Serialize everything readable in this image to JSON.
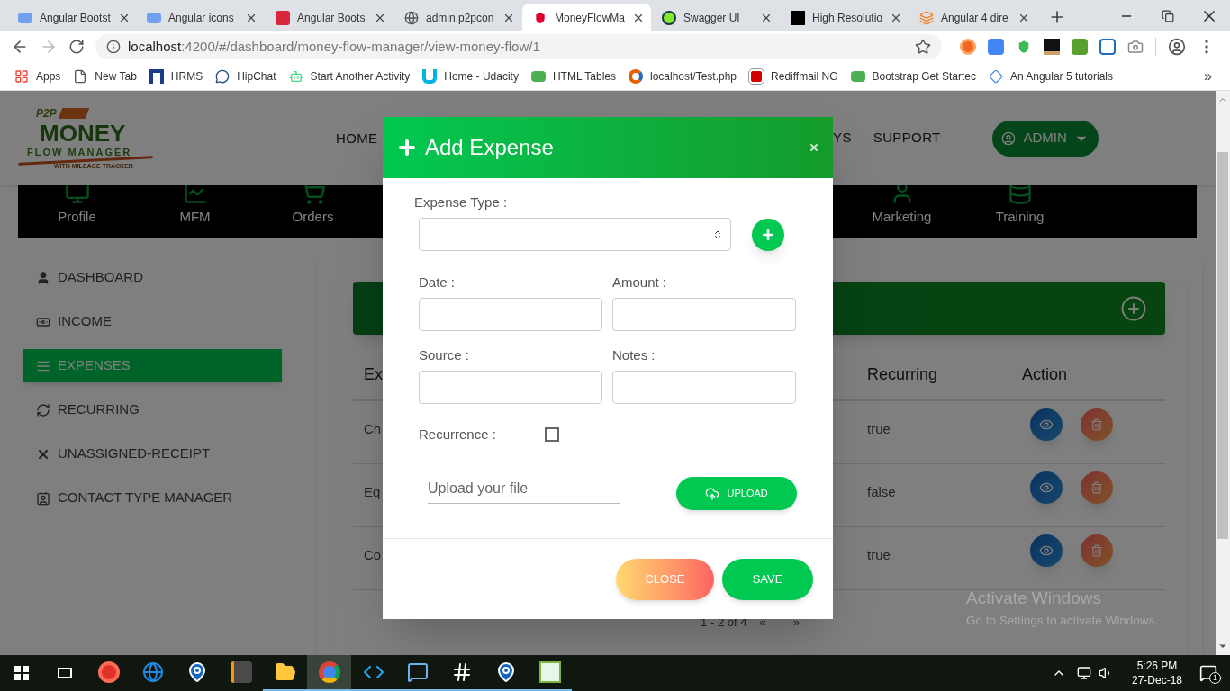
{
  "browser": {
    "tabs": [
      {
        "title": "Angular Bootst",
        "kind": "mdb",
        "selected": false
      },
      {
        "title": "Angular icons",
        "kind": "mdb",
        "selected": false
      },
      {
        "title": "Angular Boots",
        "kind": "bootstrap",
        "selected": false
      },
      {
        "title": "admin.p2pcon",
        "kind": "globe",
        "selected": false
      },
      {
        "title": "MoneyFlowMa",
        "kind": "angular",
        "selected": true
      },
      {
        "title": "Swagger UI",
        "kind": "swagger",
        "selected": false
      },
      {
        "title": "High Resolutio",
        "kind": "blocks",
        "selected": false
      },
      {
        "title": "Angular 4 dire",
        "kind": "stack",
        "selected": false
      }
    ],
    "address": {
      "host": "localhost",
      "rest": ":4200/#/dashboard/money-flow-manager/view-money-flow/1"
    },
    "bookmarks": [
      {
        "label": "Apps",
        "kind": "apps"
      },
      {
        "label": "New Tab",
        "kind": "page"
      },
      {
        "label": "HRMS",
        "kind": "hrms"
      },
      {
        "label": "HipChat",
        "kind": "chat"
      },
      {
        "label": "Start Another Activity",
        "kind": "android"
      },
      {
        "label": "Home - Udacity",
        "kind": "udacity"
      },
      {
        "label": "HTML Tables",
        "kind": "w3"
      },
      {
        "label": "localhost/Test.php",
        "kind": "swirl"
      },
      {
        "label": "Rediffmail NG",
        "kind": "rediff"
      },
      {
        "label": "Bootstrap Get Startec",
        "kind": "w3"
      },
      {
        "label": "An Angular 5 tutorials",
        "kind": "diamond"
      }
    ],
    "more": "»"
  },
  "header": {
    "logo": {
      "badge": "P2P",
      "name": "MONEY",
      "subtitle": "FLOW MANAGER",
      "tagline": "WITH MILEAGE TRACKER"
    },
    "nav": [
      {
        "label": "HOME"
      },
      {
        "label": "YS"
      },
      {
        "label": "SUPPORT"
      }
    ],
    "user": "ADMIN"
  },
  "modules": [
    {
      "label": "Profile",
      "kind": "monitor"
    },
    {
      "label": "MFM",
      "kind": "chart"
    },
    {
      "label": "Orders",
      "kind": "cart"
    },
    {
      "label": "Marketing",
      "kind": "user"
    },
    {
      "label": "Training",
      "kind": "database"
    }
  ],
  "sidebar": [
    {
      "label": "DASHBOARD",
      "kind": "user",
      "selected": false
    },
    {
      "label": "INCOME",
      "kind": "money",
      "selected": false
    },
    {
      "label": "EXPENSES",
      "kind": "list",
      "selected": true
    },
    {
      "label": "RECURRING",
      "kind": "refresh",
      "selected": false
    },
    {
      "label": "UNASSIGNED-RECEIPT",
      "kind": "x",
      "selected": false
    },
    {
      "label": "CONTACT TYPE MANAGER",
      "kind": "card",
      "selected": false
    }
  ],
  "table": {
    "columns": [
      "Ex",
      "Recurring",
      "Action"
    ],
    "rows": [
      {
        "column_1": "Ch",
        "recurring": "true"
      },
      {
        "column_1": "Eq",
        "recurring": "false"
      },
      {
        "column_1": "Co",
        "recurring": "true"
      }
    ]
  },
  "pagination": {
    "range": "1 - 2 of 4",
    "prev": "«",
    "next": "»"
  },
  "modal": {
    "title": "Add Expense",
    "fields": [
      {
        "label": "Expense Type :",
        "kind": "select"
      },
      {
        "label": "Date :",
        "kind": "text"
      },
      {
        "label": "Amount :",
        "kind": "text"
      },
      {
        "label": "Source :",
        "kind": "text"
      },
      {
        "label": "Notes :",
        "kind": "text"
      }
    ],
    "recurrence": {
      "label": "Recurrence :",
      "checked": false
    },
    "upload": {
      "placeholder": "Upload your file",
      "button": "UPLOAD"
    },
    "buttons": [
      {
        "label": "CLOSE",
        "kind": "secondary"
      },
      {
        "label": "SAVE",
        "kind": "primary"
      }
    ]
  },
  "os_notice": {
    "title": "Activate Windows",
    "text": "Go to Settings to activate Windows."
  },
  "taskbar": {
    "apps": [
      {
        "kind": "opera",
        "running": false,
        "selected": false
      },
      {
        "kind": "edge",
        "running": false,
        "selected": false
      },
      {
        "kind": "pin",
        "running": false,
        "selected": false
      },
      {
        "kind": "sublime",
        "running": false,
        "selected": false
      },
      {
        "kind": "folder",
        "running": true,
        "selected": false
      },
      {
        "kind": "chrome",
        "running": true,
        "selected": true
      },
      {
        "kind": "vscode",
        "running": true,
        "selected": false
      },
      {
        "kind": "chat",
        "running": true,
        "selected": false
      },
      {
        "kind": "slack",
        "running": true,
        "selected": false
      },
      {
        "kind": "pin",
        "running": true,
        "selected": false
      },
      {
        "kind": "notepad",
        "running": true,
        "selected": false
      }
    ],
    "time": "5:26 PM",
    "date": "27-Dec-18",
    "notifications": "1"
  }
}
